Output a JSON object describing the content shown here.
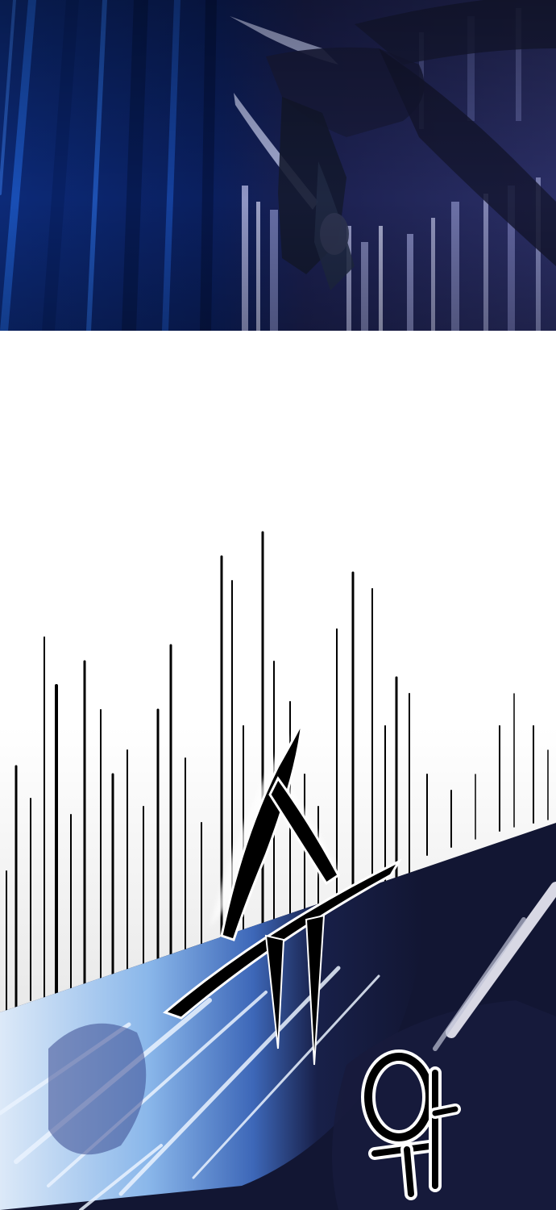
{
  "sfx": {
    "primary": "슈",
    "secondary": "와"
  },
  "colors": {
    "night_blue": "#0b1d52",
    "deep_navy": "#121633",
    "speed_light": "#bcd8f4",
    "ink": "#000000",
    "paper": "#ffffff"
  }
}
